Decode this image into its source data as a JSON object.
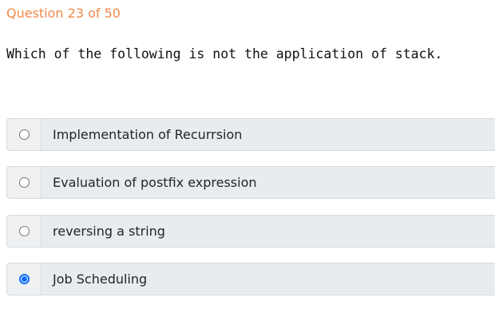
{
  "quiz": {
    "counter": "Question 23 of 50",
    "question_text": "Which of the following is not the application of stack.",
    "options": [
      {
        "label": "Implementation of Recurrsion",
        "selected": false
      },
      {
        "label": "Evaluation of postfix expression",
        "selected": false
      },
      {
        "label": "reversing a string",
        "selected": false
      },
      {
        "label": "Job Scheduling",
        "selected": true
      }
    ]
  },
  "colors": {
    "counter": "#f08a4b",
    "accent": "#0d6efd",
    "option_bg": "#e9ecef",
    "option_border": "#d7dadd"
  }
}
